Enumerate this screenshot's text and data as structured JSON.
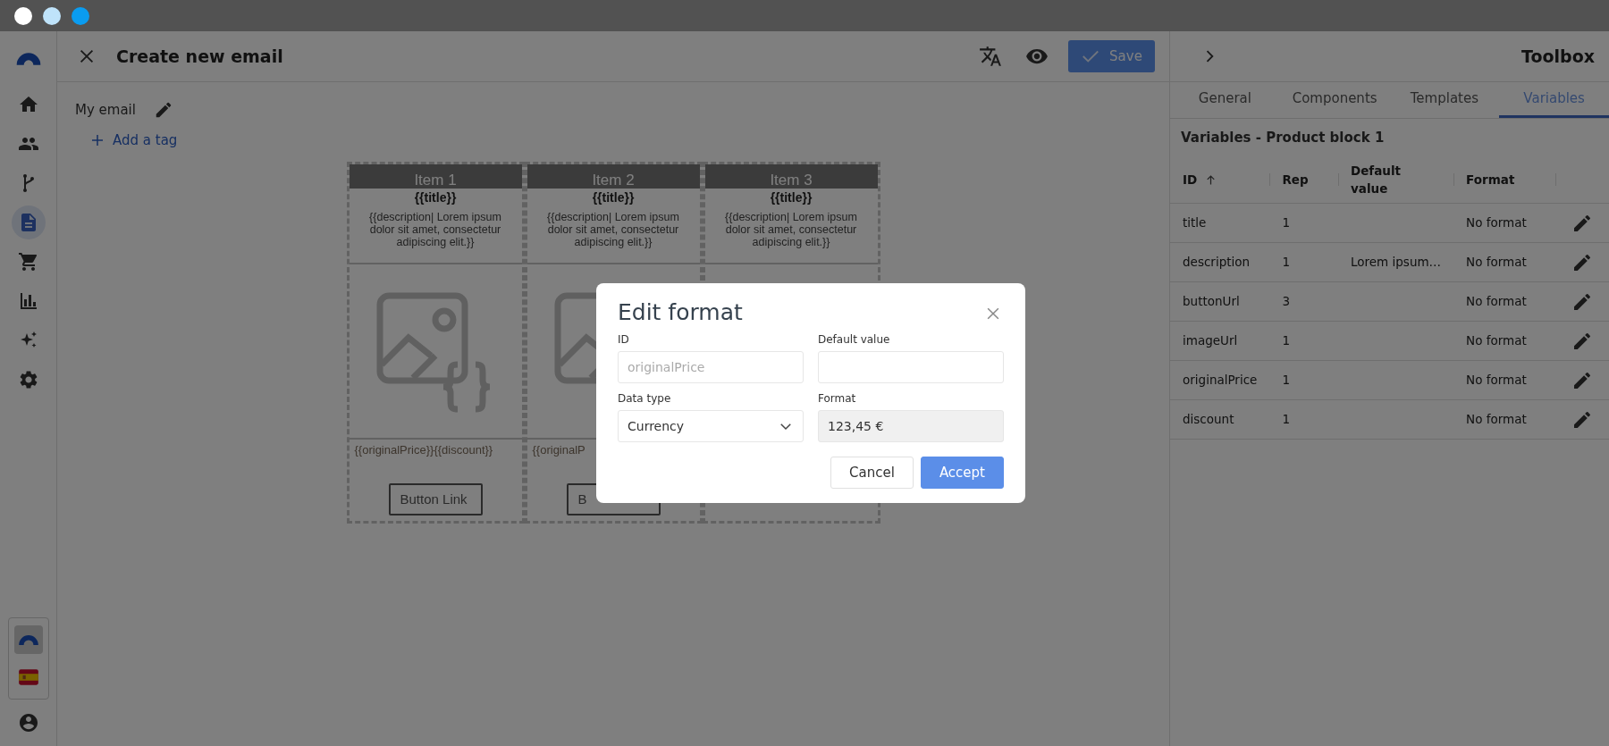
{
  "header": {
    "title": "Create new email",
    "save_label": "Save"
  },
  "sidebar": {
    "items": [
      {
        "kind": "home",
        "selected": false
      },
      {
        "kind": "people",
        "selected": false
      },
      {
        "kind": "flow",
        "selected": false
      },
      {
        "kind": "document",
        "selected": true
      },
      {
        "kind": "cart",
        "selected": false
      },
      {
        "kind": "chart",
        "selected": false
      },
      {
        "kind": "sparkle",
        "selected": false
      },
      {
        "kind": "settings",
        "selected": false
      }
    ],
    "apps": [
      {
        "kind": "logo",
        "selected": true
      },
      {
        "kind": "flag",
        "selected": false
      }
    ]
  },
  "email": {
    "name": "My email",
    "add_tag": "Add a tag",
    "items": [
      {
        "heading": "Item 1",
        "title": "{{title}}",
        "description": "{{description| Lorem ipsum dolor sit amet, consectetur adipiscing elit.}}",
        "price": "{{originalPrice}}{{discount}}",
        "button": "Button Link"
      },
      {
        "heading": "Item 2",
        "title": "{{title}}",
        "description": "{{description| Lorem ipsum dolor sit amet, consectetur adipiscing elit.}}",
        "price": "{{originalP",
        "button": "B"
      },
      {
        "heading": "Item 3",
        "title": "{{title}}",
        "description": "{{description| Lorem ipsum dolor sit amet, consectetur adipiscing elit.}}"
      }
    ]
  },
  "toolbox": {
    "title": "Toolbox",
    "tabs": [
      {
        "label": "General",
        "selected": false
      },
      {
        "label": "Components",
        "selected": false
      },
      {
        "label": "Templates",
        "selected": false
      },
      {
        "label": "Variables",
        "selected": true
      }
    ],
    "section_title": "Variables - Product block 1",
    "columns": [
      {
        "label": "ID",
        "sorted": true
      },
      {
        "label": "Rep",
        "sorted": false
      },
      {
        "label": "Default value",
        "sorted": false
      },
      {
        "label": "Format",
        "sorted": false
      }
    ],
    "rows": [
      {
        "id": "title",
        "rep": "1",
        "format": "No format"
      },
      {
        "id": "description",
        "rep": "1",
        "default_value": "Lorem ipsum…",
        "format": "No format"
      },
      {
        "id": "buttonUrl",
        "rep": "3",
        "format": "No format"
      },
      {
        "id": "imageUrl",
        "rep": "1",
        "format": "No format"
      },
      {
        "id": "originalPrice",
        "rep": "1",
        "format": "No format"
      },
      {
        "id": "discount",
        "rep": "1",
        "format": "No format"
      }
    ]
  },
  "modal": {
    "title": "Edit format",
    "fields": [
      {
        "kind": "text",
        "label": "ID",
        "placeholder": "originalPrice",
        "readonly": false
      },
      {
        "kind": "text",
        "label": "Default value",
        "readonly": false
      },
      {
        "kind": "select",
        "label": "Data type",
        "value": "Currency",
        "readonly": false
      },
      {
        "kind": "text",
        "label": "Format",
        "value": "123,45 €",
        "readonly": true
      }
    ],
    "buttons": [
      {
        "label": "Cancel",
        "primary": false
      },
      {
        "label": "Accept",
        "primary": true
      }
    ]
  }
}
